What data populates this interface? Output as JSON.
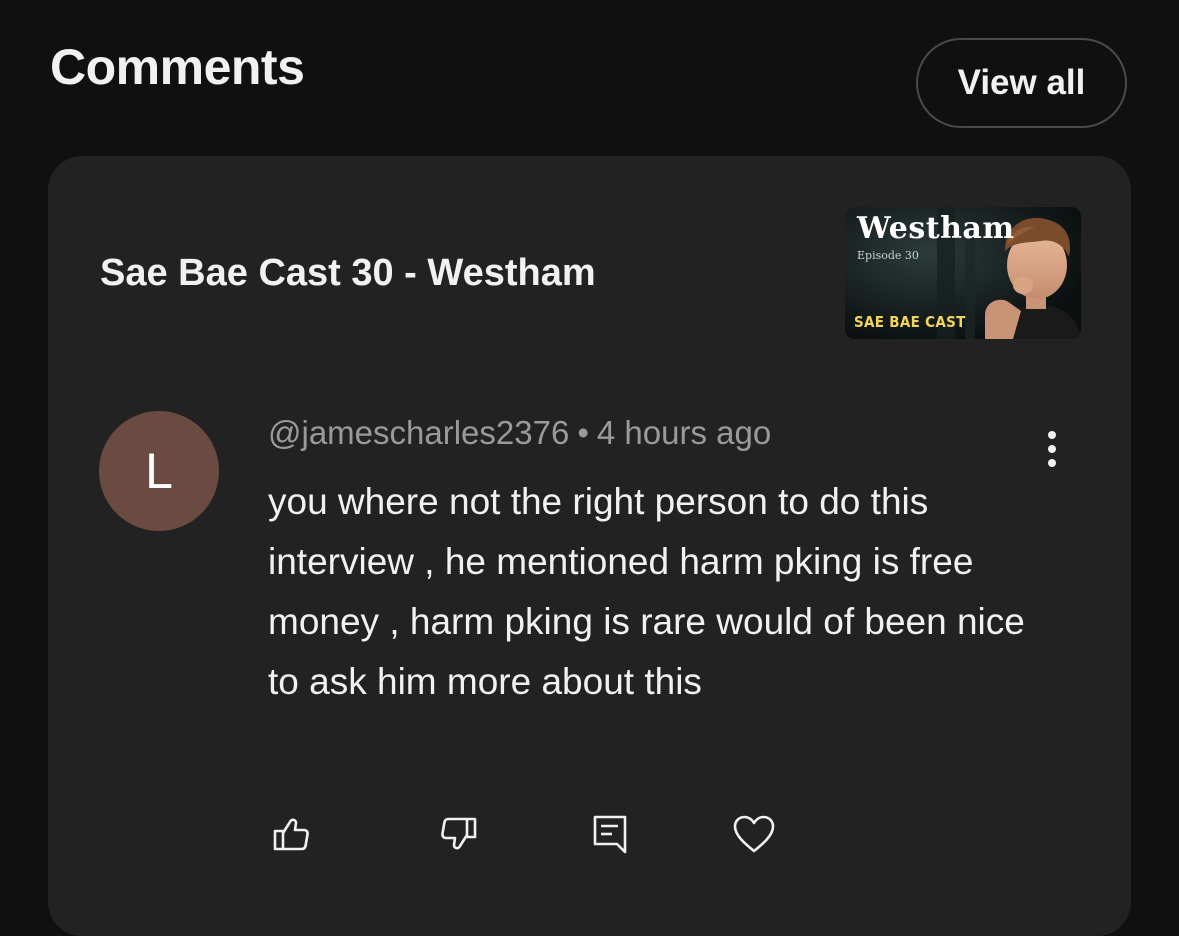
{
  "header": {
    "title": "Comments",
    "view_all_label": "View all"
  },
  "card": {
    "video_title": "Sae Bae Cast 30 - Westham",
    "thumbnail": {
      "title_text": "Westham",
      "episode_text": "Episode 30",
      "show_text": "SAE BAE CAST"
    },
    "comment": {
      "avatar_letter": "L",
      "avatar_color": "#6b4a42",
      "author": "@jamescharles2376",
      "separator": "•",
      "time": "4 hours ago",
      "text": "you where not the right person to do this interview , he mentioned harm pking is free money , harm pking is rare would of been nice to ask him more about this"
    },
    "actions": {
      "like_icon": "thumbs-up-icon",
      "dislike_icon": "thumbs-down-icon",
      "reply_icon": "reply-icon",
      "heart_icon": "heart-icon",
      "more_icon": "more-vertical-icon"
    }
  },
  "colors": {
    "background": "#101010",
    "card": "#222222",
    "text_primary": "#f1f1f1",
    "text_secondary": "#9a9a9a",
    "thumbnail_accent": "#f2d45a"
  }
}
